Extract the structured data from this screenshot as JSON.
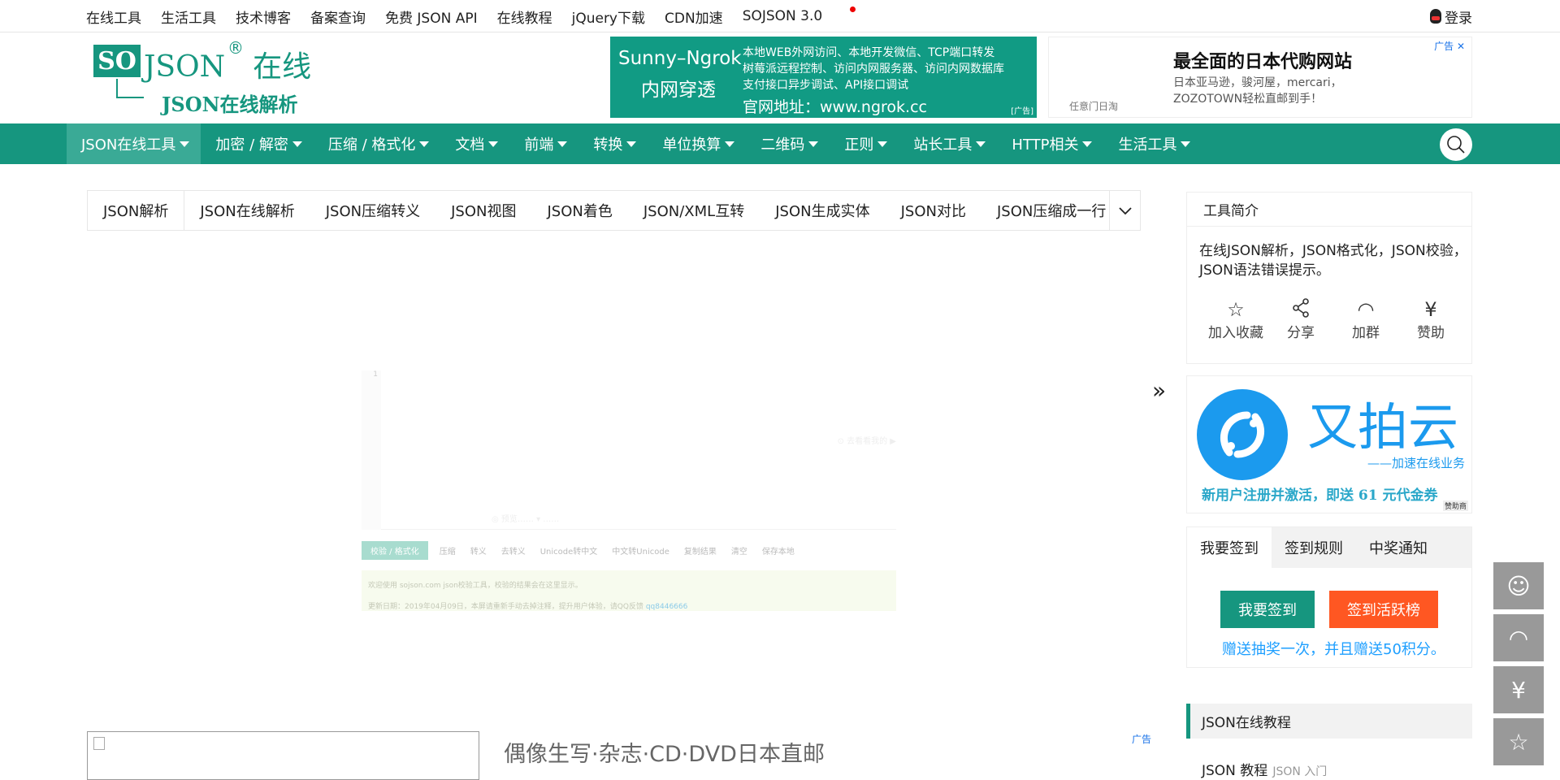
{
  "topbar": {
    "links": [
      "在线工具",
      "生活工具",
      "技术博客",
      "备案查询",
      "免费 JSON API",
      "在线教程",
      "jQuery下载",
      "CDN加速",
      "SOJSON 3.0"
    ],
    "login": "登录"
  },
  "logo": {
    "so": "SO",
    "json": "JSON",
    "reg": "®",
    "cn": "在线",
    "subtitle": "JSON在线解析"
  },
  "ad_ngrok": {
    "title1": "Sunny–Ngrok",
    "title2": "内网穿透",
    "lines": [
      "本地WEB外网访问、本地开发微信、TCP端口转发",
      "树莓派远程控制、访问内网服务器、访问内网数据库",
      "支付接口异步调试、API接口调试"
    ],
    "site": "官网地址：www.ngrok.cc",
    "tag": "[广告]"
  },
  "ad_japan": {
    "title": "最全面的日本代购网站",
    "desc1": "日本亚马逊，骏河屋，mercari，",
    "desc2": "ZOZOTOWN轻松直邮到手！",
    "store": "任意门日淘",
    "tag": "广告 ✕"
  },
  "nav": {
    "items": [
      "JSON在线工具",
      "加密 / 解密",
      "压缩 / 格式化",
      "文档",
      "前端",
      "转换",
      "单位换算",
      "二维码",
      "正则",
      "站长工具",
      "HTTP相关",
      "生活工具"
    ]
  },
  "tabs": [
    "JSON解析",
    "JSON在线解析",
    "JSON压缩转义",
    "JSON视图",
    "JSON着色",
    "JSON/XML互转",
    "JSON生成实体",
    "JSON对比",
    "JSON压缩成一行"
  ],
  "editor": {
    "line": "1",
    "hint": "⊙ 去看看我的 ▶",
    "bottom": "◎ 预览……  ▾  ……"
  },
  "toolbar": [
    "校验 / 格式化",
    "压缩",
    "转义",
    "去转义",
    "Unicode转中文",
    "中文转Unicode",
    "复制结果",
    "清空",
    "保存本地"
  ],
  "notice": {
    "line1": "欢迎使用 sojson.com json校验工具，校验的结果会在这里显示。",
    "line2": "更新日期：2019年04月09日，本屏请重新手动去掉注释，提升用户体验，请QQ反馈 ",
    "qq": "qq8446666"
  },
  "expand_icon": "»",
  "bottom_ad": {
    "title": "偶像生写·杂志·CD·DVD日本直邮",
    "tag": "广告"
  },
  "intro": {
    "title": "工具简介",
    "desc": "在线JSON解析，JSON格式化，JSON校验，JSON语法错误提示。",
    "actions": [
      {
        "icon": "☆",
        "label": "加入收藏"
      },
      {
        "icon": "⋖",
        "label": "分享"
      },
      {
        "icon": "◠",
        "label": "加群"
      },
      {
        "icon": "¥",
        "label": "赞助"
      }
    ]
  },
  "upyun": {
    "name": "又拍云",
    "slogan": "——加速在线业务",
    "promo": "新用户注册并激活，即送 61 元代金券",
    "tag": "赞助商"
  },
  "sign": {
    "tabs": [
      "我要签到",
      "签到规则",
      "中奖通知"
    ],
    "btn_sign": "我要签到",
    "btn_rank": "签到活跃榜",
    "note": "赠送抽奖一次，并且赠送50积分。"
  },
  "tutorial": {
    "title": "JSON在线教程",
    "item": "JSON 教程",
    "item_sub": "JSON 入门"
  },
  "floating": [
    "☺",
    "◠",
    "¥",
    "☆"
  ],
  "colors": {
    "brand": "#16967f",
    "orange": "#ff5722",
    "blue": "#1e9fff"
  }
}
